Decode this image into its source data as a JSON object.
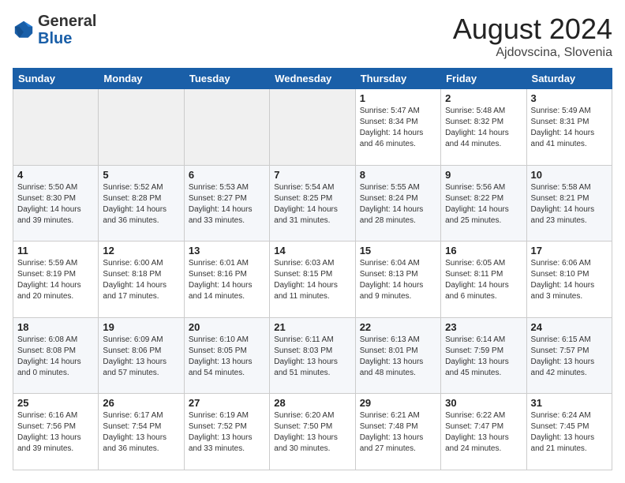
{
  "header": {
    "logo_general": "General",
    "logo_blue": "Blue",
    "month_year": "August 2024",
    "location": "Ajdovscina, Slovenia"
  },
  "days_of_week": [
    "Sunday",
    "Monday",
    "Tuesday",
    "Wednesday",
    "Thursday",
    "Friday",
    "Saturday"
  ],
  "weeks": [
    [
      {
        "day": "",
        "info": ""
      },
      {
        "day": "",
        "info": ""
      },
      {
        "day": "",
        "info": ""
      },
      {
        "day": "",
        "info": ""
      },
      {
        "day": "1",
        "info": "Sunrise: 5:47 AM\nSunset: 8:34 PM\nDaylight: 14 hours and 46 minutes."
      },
      {
        "day": "2",
        "info": "Sunrise: 5:48 AM\nSunset: 8:32 PM\nDaylight: 14 hours and 44 minutes."
      },
      {
        "day": "3",
        "info": "Sunrise: 5:49 AM\nSunset: 8:31 PM\nDaylight: 14 hours and 41 minutes."
      }
    ],
    [
      {
        "day": "4",
        "info": "Sunrise: 5:50 AM\nSunset: 8:30 PM\nDaylight: 14 hours and 39 minutes."
      },
      {
        "day": "5",
        "info": "Sunrise: 5:52 AM\nSunset: 8:28 PM\nDaylight: 14 hours and 36 minutes."
      },
      {
        "day": "6",
        "info": "Sunrise: 5:53 AM\nSunset: 8:27 PM\nDaylight: 14 hours and 33 minutes."
      },
      {
        "day": "7",
        "info": "Sunrise: 5:54 AM\nSunset: 8:25 PM\nDaylight: 14 hours and 31 minutes."
      },
      {
        "day": "8",
        "info": "Sunrise: 5:55 AM\nSunset: 8:24 PM\nDaylight: 14 hours and 28 minutes."
      },
      {
        "day": "9",
        "info": "Sunrise: 5:56 AM\nSunset: 8:22 PM\nDaylight: 14 hours and 25 minutes."
      },
      {
        "day": "10",
        "info": "Sunrise: 5:58 AM\nSunset: 8:21 PM\nDaylight: 14 hours and 23 minutes."
      }
    ],
    [
      {
        "day": "11",
        "info": "Sunrise: 5:59 AM\nSunset: 8:19 PM\nDaylight: 14 hours and 20 minutes."
      },
      {
        "day": "12",
        "info": "Sunrise: 6:00 AM\nSunset: 8:18 PM\nDaylight: 14 hours and 17 minutes."
      },
      {
        "day": "13",
        "info": "Sunrise: 6:01 AM\nSunset: 8:16 PM\nDaylight: 14 hours and 14 minutes."
      },
      {
        "day": "14",
        "info": "Sunrise: 6:03 AM\nSunset: 8:15 PM\nDaylight: 14 hours and 11 minutes."
      },
      {
        "day": "15",
        "info": "Sunrise: 6:04 AM\nSunset: 8:13 PM\nDaylight: 14 hours and 9 minutes."
      },
      {
        "day": "16",
        "info": "Sunrise: 6:05 AM\nSunset: 8:11 PM\nDaylight: 14 hours and 6 minutes."
      },
      {
        "day": "17",
        "info": "Sunrise: 6:06 AM\nSunset: 8:10 PM\nDaylight: 14 hours and 3 minutes."
      }
    ],
    [
      {
        "day": "18",
        "info": "Sunrise: 6:08 AM\nSunset: 8:08 PM\nDaylight: 14 hours and 0 minutes."
      },
      {
        "day": "19",
        "info": "Sunrise: 6:09 AM\nSunset: 8:06 PM\nDaylight: 13 hours and 57 minutes."
      },
      {
        "day": "20",
        "info": "Sunrise: 6:10 AM\nSunset: 8:05 PM\nDaylight: 13 hours and 54 minutes."
      },
      {
        "day": "21",
        "info": "Sunrise: 6:11 AM\nSunset: 8:03 PM\nDaylight: 13 hours and 51 minutes."
      },
      {
        "day": "22",
        "info": "Sunrise: 6:13 AM\nSunset: 8:01 PM\nDaylight: 13 hours and 48 minutes."
      },
      {
        "day": "23",
        "info": "Sunrise: 6:14 AM\nSunset: 7:59 PM\nDaylight: 13 hours and 45 minutes."
      },
      {
        "day": "24",
        "info": "Sunrise: 6:15 AM\nSunset: 7:57 PM\nDaylight: 13 hours and 42 minutes."
      }
    ],
    [
      {
        "day": "25",
        "info": "Sunrise: 6:16 AM\nSunset: 7:56 PM\nDaylight: 13 hours and 39 minutes."
      },
      {
        "day": "26",
        "info": "Sunrise: 6:17 AM\nSunset: 7:54 PM\nDaylight: 13 hours and 36 minutes."
      },
      {
        "day": "27",
        "info": "Sunrise: 6:19 AM\nSunset: 7:52 PM\nDaylight: 13 hours and 33 minutes."
      },
      {
        "day": "28",
        "info": "Sunrise: 6:20 AM\nSunset: 7:50 PM\nDaylight: 13 hours and 30 minutes."
      },
      {
        "day": "29",
        "info": "Sunrise: 6:21 AM\nSunset: 7:48 PM\nDaylight: 13 hours and 27 minutes."
      },
      {
        "day": "30",
        "info": "Sunrise: 6:22 AM\nSunset: 7:47 PM\nDaylight: 13 hours and 24 minutes."
      },
      {
        "day": "31",
        "info": "Sunrise: 6:24 AM\nSunset: 7:45 PM\nDaylight: 13 hours and 21 minutes."
      }
    ]
  ]
}
